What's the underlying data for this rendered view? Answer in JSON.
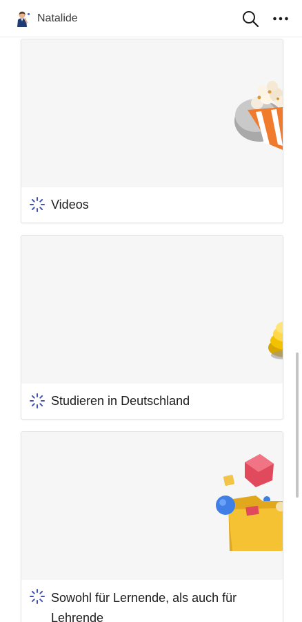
{
  "header": {
    "app_name": "Natalide",
    "avatar_icon": "teacher-avatar-icon",
    "search_icon": "search-icon",
    "more_icon": "more-dots-icon"
  },
  "cards": [
    {
      "title": "Videos",
      "icon": "loading-spinner-icon",
      "art": "popcorn-bucket"
    },
    {
      "title": "Studieren in Deutschland",
      "icon": "loading-spinner-icon",
      "art": "yellow-stack"
    },
    {
      "title": "Sowohl für Lernende, als auch für Lehrende",
      "icon": "loading-spinner-icon",
      "art": "folder-with-shapes"
    }
  ],
  "colors": {
    "accent": "#3f51b5",
    "card_bg": "#f6f6f6",
    "border": "#e3e3e3"
  }
}
